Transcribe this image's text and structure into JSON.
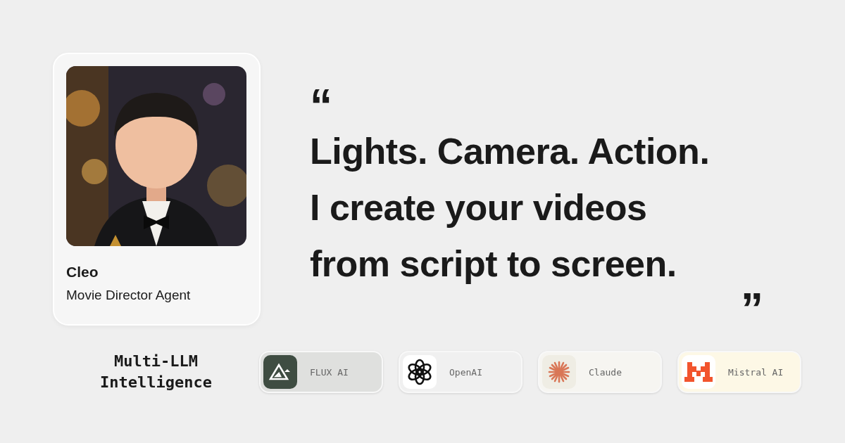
{
  "profile": {
    "kind": "picture",
    "name": "Cleo",
    "role": "Movie Director Agent"
  },
  "quote": {
    "open_mark": "“",
    "lines": [
      "Lights. Camera. Action.",
      "I create your videos",
      "from script to screen."
    ],
    "close_mark": "”"
  },
  "models_heading": {
    "lines": [
      "Multi-LLM",
      "Intelligence"
    ]
  },
  "models": [
    {
      "name": "FLUX AI",
      "kind": "flux",
      "color": "#dfe0de"
    },
    {
      "name": "OpenAI",
      "kind": "openai",
      "color": "#f0f0f0"
    },
    {
      "name": "Claude",
      "kind": "claude",
      "color": "#f6f5f1"
    },
    {
      "name": "Mistral AI",
      "kind": "mistral",
      "color": "#fdf8e6"
    }
  ]
}
